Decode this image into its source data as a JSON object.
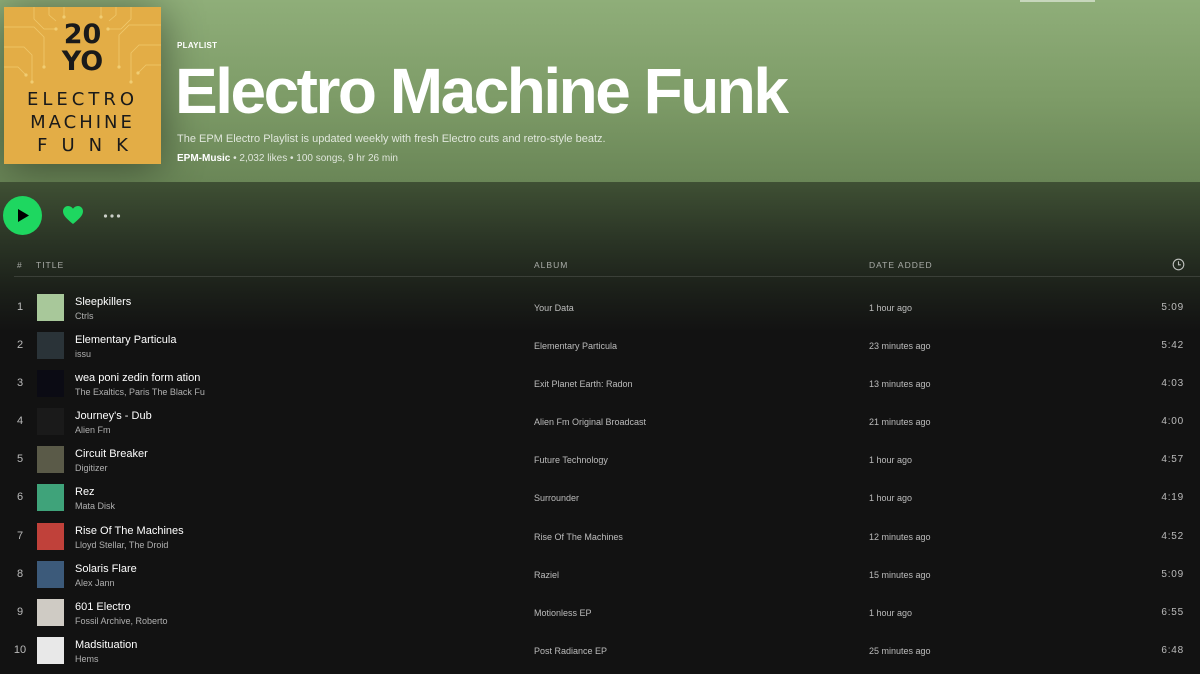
{
  "playlist": {
    "type_label": "PLAYLIST",
    "title": "Electro Machine Funk",
    "description": "The EPM Electro Playlist is updated weekly with fresh Electro cuts and retro-style beatz.",
    "owner": "EPM-Music",
    "stats": " • 2,032 likes • 100 songs, 9 hr 26 min",
    "cover": {
      "line_20": "20",
      "line_yo": "YO",
      "line_1": "ELECTRO",
      "line_2": "MACHINE",
      "line_3": "FUNK",
      "color": "#e3ad46"
    }
  },
  "controls": {
    "play_icon": "play-icon",
    "like_icon": "heart-icon",
    "more_icon": "more-icon",
    "accent": "#1ed760"
  },
  "columns": {
    "num": "#",
    "title": "TITLE",
    "album": "ALBUM",
    "date_added": "DATE ADDED",
    "duration_icon": "clock-icon"
  },
  "tracks": [
    {
      "num": "1",
      "title": "Sleepkillers",
      "artist": "Ctrls",
      "album": "Your Data",
      "added": "1 hour ago",
      "duration": "5:09",
      "art_color": "#a8c89a"
    },
    {
      "num": "2",
      "title": "Elementary Particula",
      "artist": "issu",
      "album": "Elementary Particula",
      "added": "23 minutes ago",
      "duration": "5:42",
      "art_color": "#2a3338"
    },
    {
      "num": "3",
      "title": "wea poni zedin form ation",
      "artist": "The Exaltics, Paris The Black Fu",
      "album": "Exit Planet Earth: Radon",
      "added": "13 minutes ago",
      "duration": "4:03",
      "art_color": "#0b0b14"
    },
    {
      "num": "4",
      "title": "Journey's - Dub",
      "artist": "Alien Fm",
      "album": "Alien Fm Original Broadcast",
      "added": "21 minutes ago",
      "duration": "4:00",
      "art_color": "#1a1a1a"
    },
    {
      "num": "5",
      "title": "Circuit Breaker",
      "artist": "Digitizer",
      "album": "Future Technology",
      "added": "1 hour ago",
      "duration": "4:57",
      "art_color": "#5a5a48"
    },
    {
      "num": "6",
      "title": "Rez",
      "artist": "Mata Disk",
      "album": "Surrounder",
      "added": "1 hour ago",
      "duration": "4:19",
      "art_color": "#3fa37a"
    },
    {
      "num": "7",
      "title": "Rise Of The Machines",
      "artist": "Lloyd Stellar, The Droid",
      "album": "Rise Of The Machines",
      "added": "12 minutes ago",
      "duration": "4:52",
      "art_color": "#c0413a"
    },
    {
      "num": "8",
      "title": "Solaris Flare",
      "artist": "Alex Jann",
      "album": "Raziel",
      "added": "15 minutes ago",
      "duration": "5:09",
      "art_color": "#3c5a7a"
    },
    {
      "num": "9",
      "title": "601 Electro",
      "artist": "Fossil Archive, Roberto",
      "album": "Motionless EP",
      "added": "1 hour ago",
      "duration": "6:55",
      "art_color": "#cfcbc4"
    },
    {
      "num": "10",
      "title": "Madsituation",
      "artist": "Hems",
      "album": "Post Radiance EP",
      "added": "25 minutes ago",
      "duration": "6:48",
      "art_color": "#e8e8e8"
    }
  ]
}
